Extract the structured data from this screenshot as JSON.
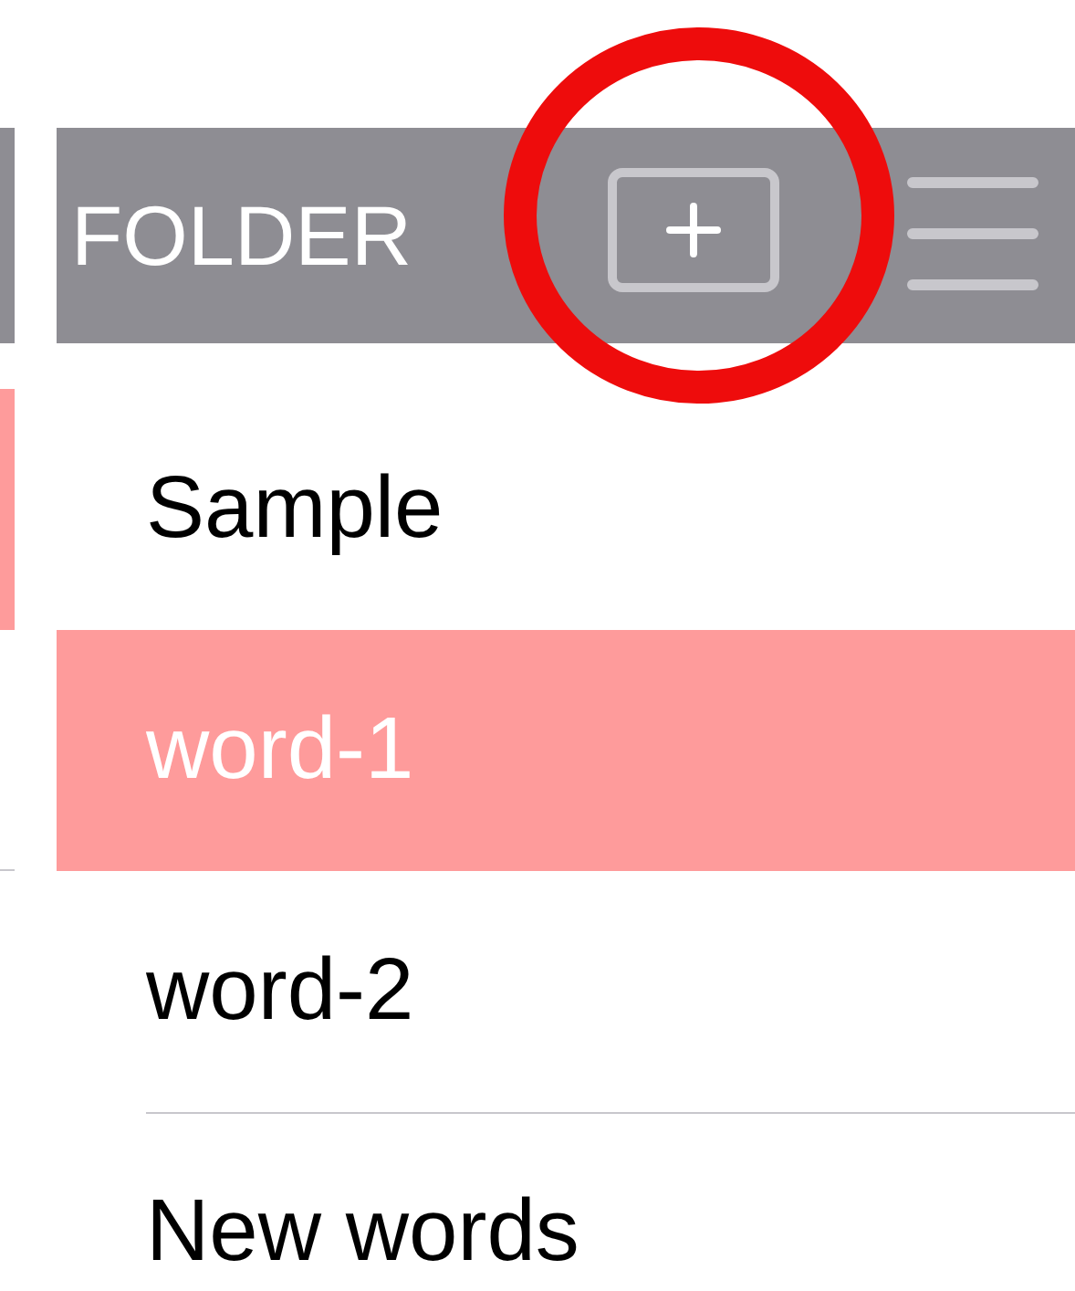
{
  "header": {
    "title": "FOLDER"
  },
  "rows": [
    {
      "label": "Sample",
      "selected": false
    },
    {
      "label": "word-1",
      "selected": true
    },
    {
      "label": "word-2",
      "selected": false
    },
    {
      "label": "New words",
      "selected": false
    }
  ],
  "annotation": {
    "kind": "circle"
  }
}
